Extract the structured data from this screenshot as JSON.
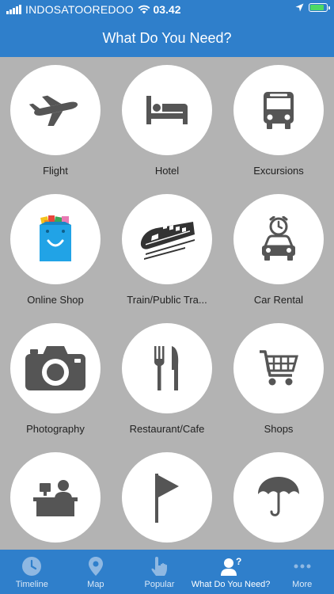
{
  "status_bar": {
    "carrier": "INDOSATOOREDOO",
    "time": "03.42"
  },
  "header": {
    "title": "What Do You Need?"
  },
  "categories": [
    {
      "label": "Flight",
      "icon": "airplane-icon"
    },
    {
      "label": "Hotel",
      "icon": "bed-icon"
    },
    {
      "label": "Excursions",
      "icon": "bus-icon"
    },
    {
      "label": "Online Shop",
      "icon": "shopping-bag-icon"
    },
    {
      "label": "Train/Public Tra...",
      "icon": "train-icon"
    },
    {
      "label": "Car Rental",
      "icon": "car-rental-icon"
    },
    {
      "label": "Photography",
      "icon": "camera-icon"
    },
    {
      "label": "Restaurant/Cafe",
      "icon": "fork-knife-icon"
    },
    {
      "label": "Shops",
      "icon": "shopping-cart-icon"
    },
    {
      "label": "",
      "icon": "reception-desk-icon"
    },
    {
      "label": "",
      "icon": "flag-icon"
    },
    {
      "label": "",
      "icon": "umbrella-icon"
    }
  ],
  "tab_bar": {
    "items": [
      {
        "label": "Timeline",
        "icon": "clock-icon"
      },
      {
        "label": "Map",
        "icon": "map-pin-icon"
      },
      {
        "label": "Popular",
        "icon": "hand-pointer-icon"
      },
      {
        "label": "What Do You Need?",
        "icon": "user-question-icon",
        "active": true
      },
      {
        "label": "More",
        "icon": "more-icon"
      }
    ]
  },
  "colors": {
    "brand_blue": "#2f7fcb",
    "background": "#b3b3b3",
    "icon_gray": "#555555"
  }
}
